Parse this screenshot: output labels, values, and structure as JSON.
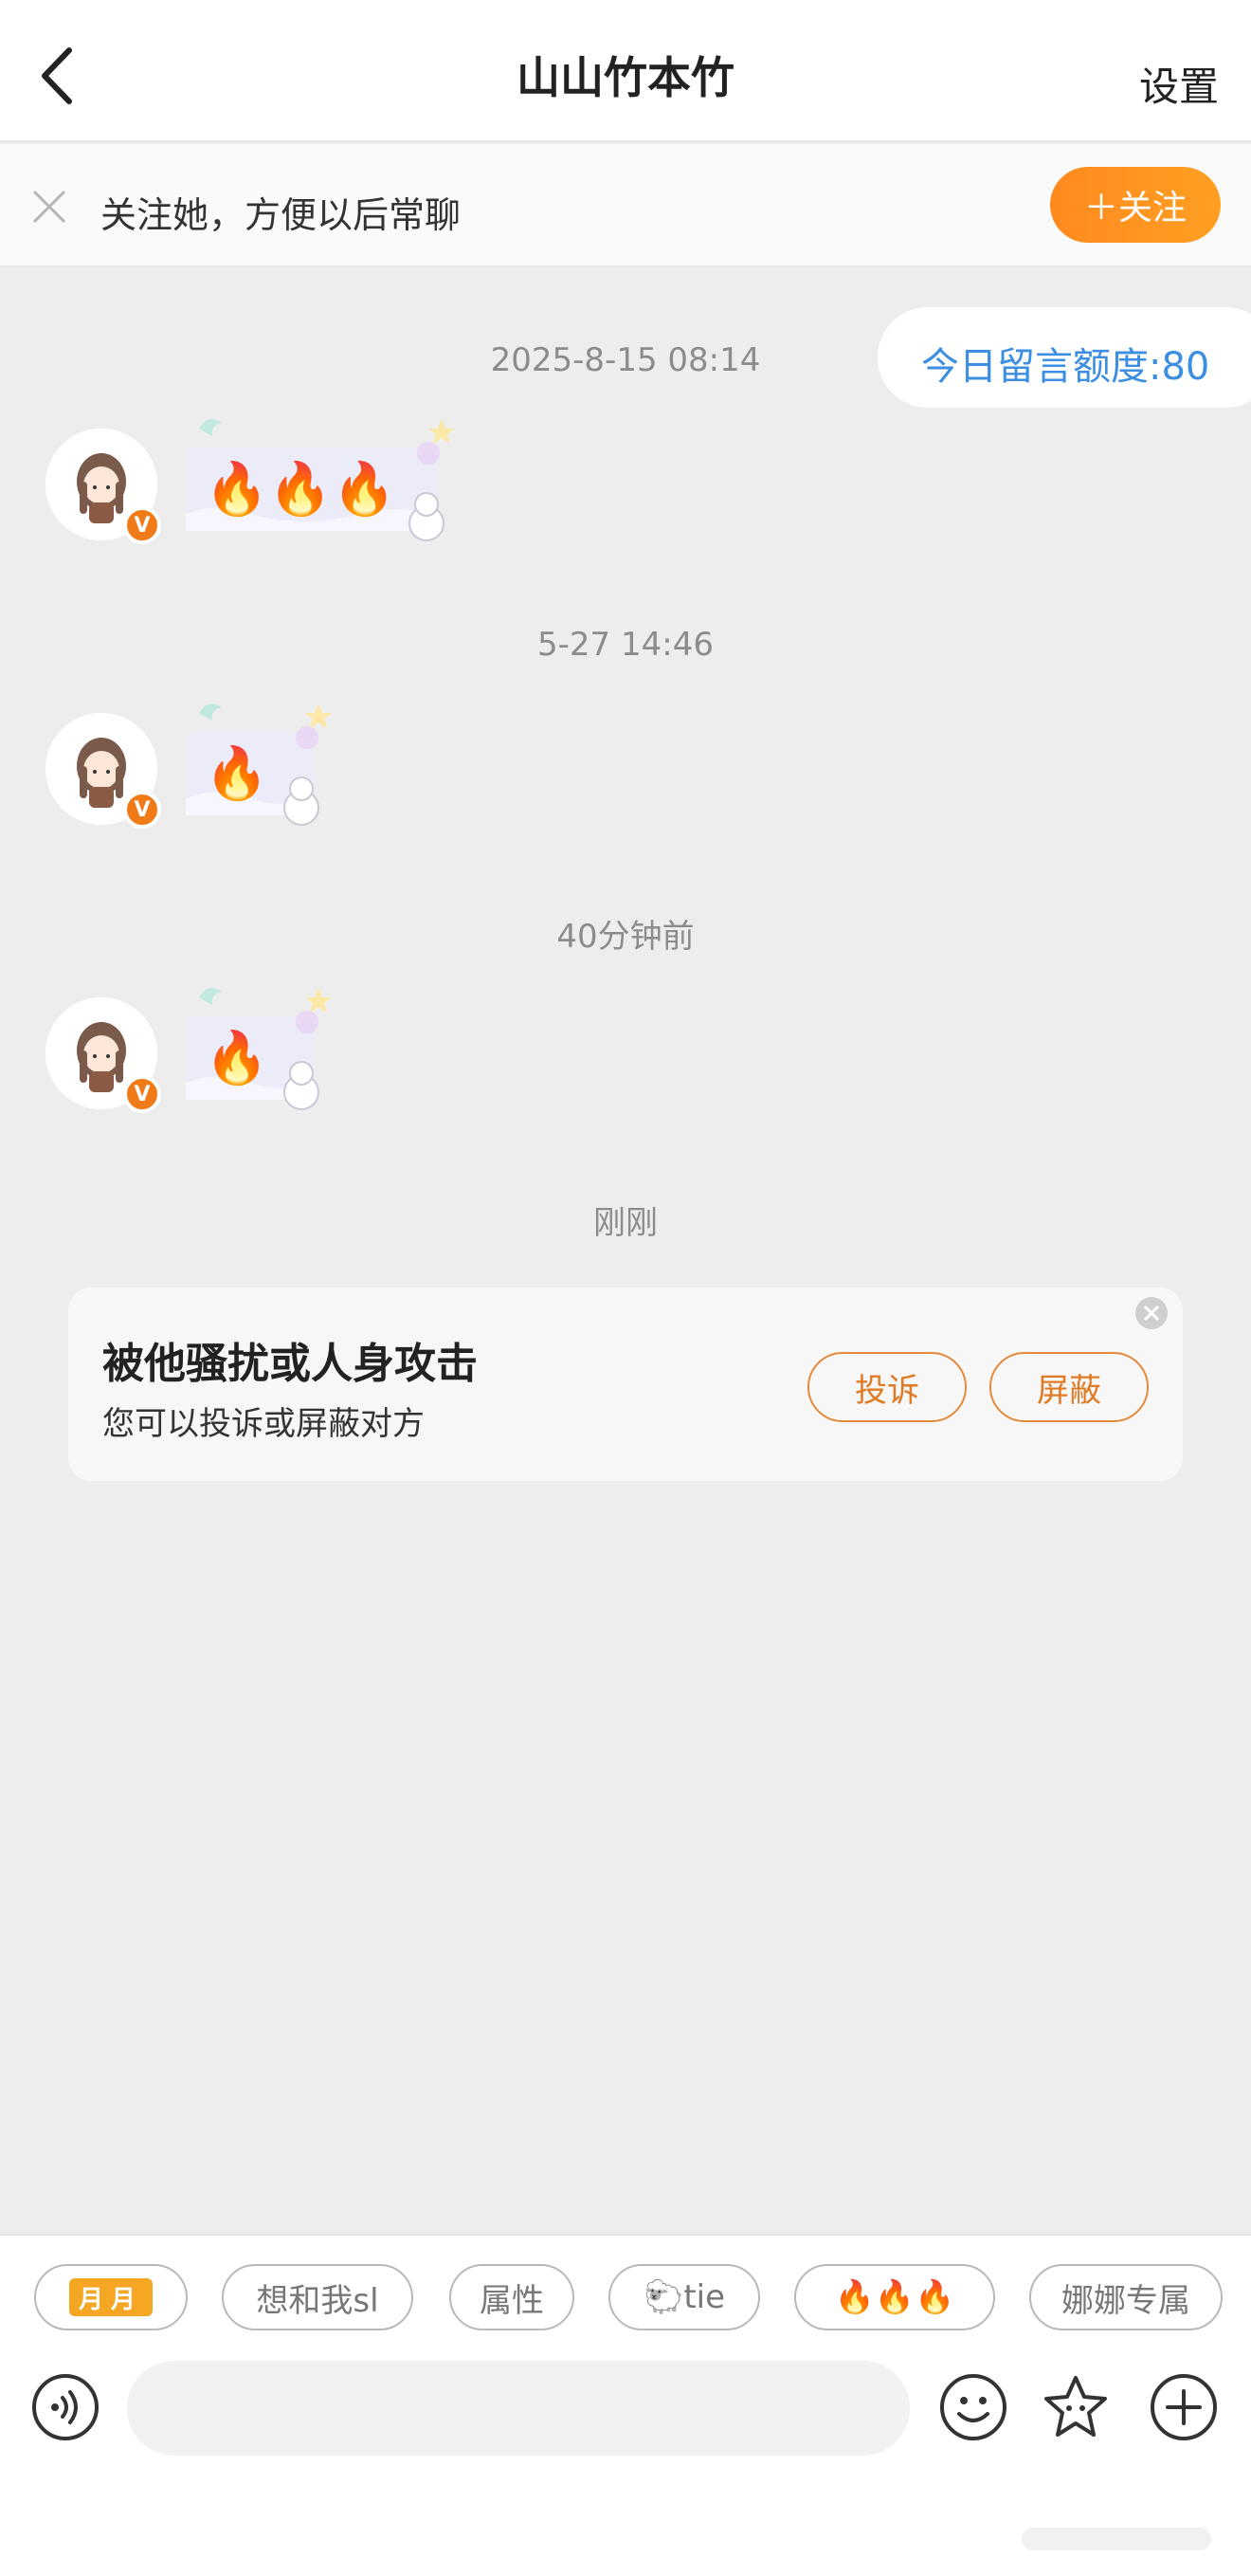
{
  "header": {
    "title": "山山竹本竹",
    "settings_label": "设置"
  },
  "follow_bar": {
    "text": "关注她，方便以后常聊",
    "follow_button_label": "＋关注"
  },
  "quota": {
    "text": "今日留言额度:80"
  },
  "messages": [
    {
      "timestamp": "2025-8-15 08:14",
      "fires": "🔥🔥🔥"
    },
    {
      "timestamp": "5-27 14:46",
      "fires": "🔥"
    },
    {
      "timestamp": "40分钟前",
      "fires": "🔥"
    }
  ],
  "last_timestamp": "刚刚",
  "report_card": {
    "title": "被他骚扰或人身攻击",
    "subtitle": "您可以投诉或屏蔽对方",
    "report_label": "投诉",
    "block_label": "屏蔽"
  },
  "quick_replies": [
    {
      "label": "月月"
    },
    {
      "label": "想和我sl"
    },
    {
      "label": "属性"
    },
    {
      "label": "🐑tie"
    },
    {
      "label": "🔥🔥🔥"
    },
    {
      "label": "娜娜专属"
    }
  ],
  "input": {
    "placeholder": ""
  },
  "icons": {
    "back": "back-arrow-icon",
    "close": "close-icon",
    "voice": "voice-icon",
    "emoji": "emoji-icon",
    "sticker": "star-sticker-icon",
    "plus": "plus-icon"
  },
  "colors": {
    "accent_orange": "#ff8a1f",
    "quota_blue": "#3c8ee2",
    "badge_orange": "#f07a17",
    "background": "#ededed"
  }
}
